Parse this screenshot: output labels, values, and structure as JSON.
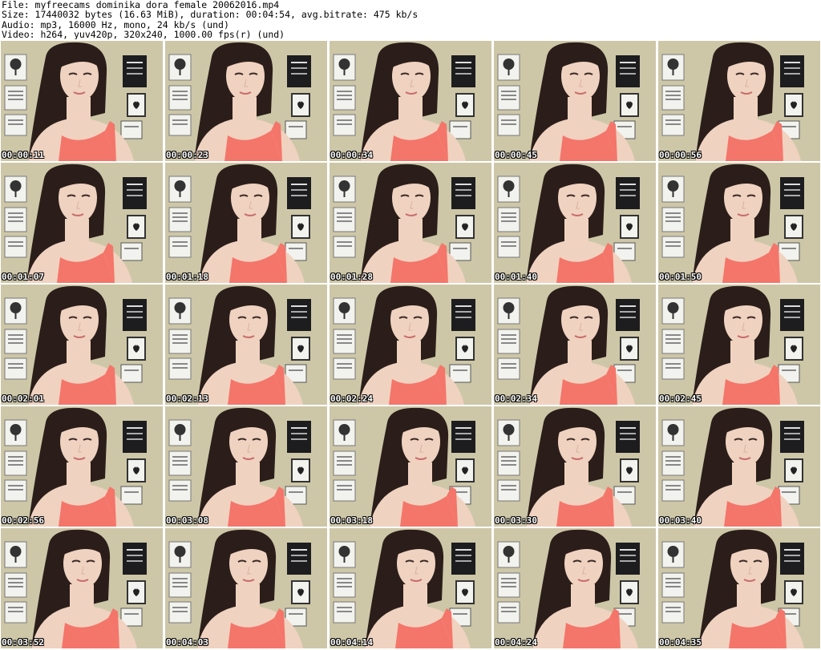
{
  "header": {
    "file_line": "File: myfreecams_dominika_dora_female_20062016.mp4",
    "size_line": "Size: 17440032 bytes (16.63 MiB), duration: 00:04:54, avg.bitrate: 475 kb/s",
    "audio_line": "Audio: mp3, 16000 Hz, mono, 24 kb/s (und)",
    "video_line": "Video: h264, yuv420p, 320x240, 1000.00 fps(r) (und)"
  },
  "thumbnails": [
    {
      "timestamp": "00:00:11"
    },
    {
      "timestamp": "00:00:23"
    },
    {
      "timestamp": "00:00:34"
    },
    {
      "timestamp": "00:00:45"
    },
    {
      "timestamp": "00:00:56"
    },
    {
      "timestamp": "00:01:07"
    },
    {
      "timestamp": "00:01:18"
    },
    {
      "timestamp": "00:01:28"
    },
    {
      "timestamp": "00:01:40"
    },
    {
      "timestamp": "00:01:50"
    },
    {
      "timestamp": "00:02:01"
    },
    {
      "timestamp": "00:02:13"
    },
    {
      "timestamp": "00:02:24"
    },
    {
      "timestamp": "00:02:34"
    },
    {
      "timestamp": "00:02:45"
    },
    {
      "timestamp": "00:02:56"
    },
    {
      "timestamp": "00:03:08"
    },
    {
      "timestamp": "00:03:18"
    },
    {
      "timestamp": "00:03:30"
    },
    {
      "timestamp": "00:03:40"
    },
    {
      "timestamp": "00:03:52"
    },
    {
      "timestamp": "00:04:03"
    },
    {
      "timestamp": "00:04:14"
    },
    {
      "timestamp": "00:04:24"
    },
    {
      "timestamp": "00:04:35"
    }
  ],
  "colors": {
    "wall": "#cdc7a8",
    "skin": "#f0d2c0",
    "hair": "#2b1e1a",
    "top": "#f4756a",
    "poster_dark": "#1d1d1f",
    "poster_light": "#f2f2ee"
  }
}
